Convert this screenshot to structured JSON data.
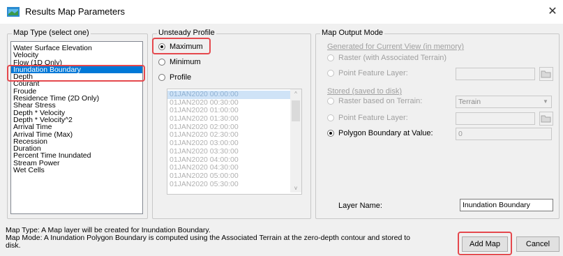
{
  "window": {
    "title": "Results Map Parameters",
    "close_glyph": "✕"
  },
  "map_type": {
    "legend": "Map Type (select one)",
    "items": [
      "Water Surface Elevation",
      "Velocity",
      "Flow (1D Only)",
      "Inundation Boundary",
      "Depth",
      "Courant",
      "Froude",
      "Residence Time (2D Only)",
      "Shear Stress",
      "Depth * Velocity",
      "Depth * Velocity^2",
      "Arrival Time",
      "Arrival Time (Max)",
      "Recession",
      "Duration",
      "Percent Time Inundated",
      "Stream Power",
      "Wet Cells"
    ],
    "selected": "Inundation Boundary"
  },
  "unsteady_profile": {
    "legend": "Unsteady Profile",
    "maximum_label": "Maximum",
    "minimum_label": "Minimum",
    "profile_label": "Profile",
    "selected": "Maximum",
    "times": [
      "01JAN2020 00:00:00",
      "01JAN2020 00:30:00",
      "01JAN2020 01:00:00",
      "01JAN2020 01:30:00",
      "01JAN2020 02:00:00",
      "01JAN2020 02:30:00",
      "01JAN2020 03:00:00",
      "01JAN2020 03:30:00",
      "01JAN2020 04:00:00",
      "01JAN2020 04:30:00",
      "01JAN2020 05:00:00",
      "01JAN2020 05:30:00"
    ]
  },
  "output_mode": {
    "legend": "Map Output Mode",
    "current_view_heading": "Generated for Current View (in memory)",
    "raster_assoc_label": "Raster (with Associated Terrain)",
    "point_feature_label_1": "Point Feature Layer:",
    "stored_heading": "Stored (saved to disk)",
    "raster_terrain_label": "Raster based on Terrain:",
    "terrain_value": "Terrain",
    "point_feature_label_2": "Point Feature Layer:",
    "polygon_label": "Polygon Boundary at Value:",
    "polygon_value": "0",
    "selected": "Polygon Boundary at Value:",
    "layer_name_label": "Layer Name:",
    "layer_name_value": "Inundation Boundary"
  },
  "status": {
    "line1": "Map Type: A Map layer will be created for Inundation Boundary.",
    "line2": "Map Mode: A Inundation Polygon Boundary is computed using the Associated Terrain at the zero-depth contour and stored to",
    "line3": "disk."
  },
  "buttons": {
    "add_map": "Add Map",
    "cancel": "Cancel"
  },
  "colors": {
    "selection": "#0078d7",
    "highlight": "#e5484d"
  }
}
